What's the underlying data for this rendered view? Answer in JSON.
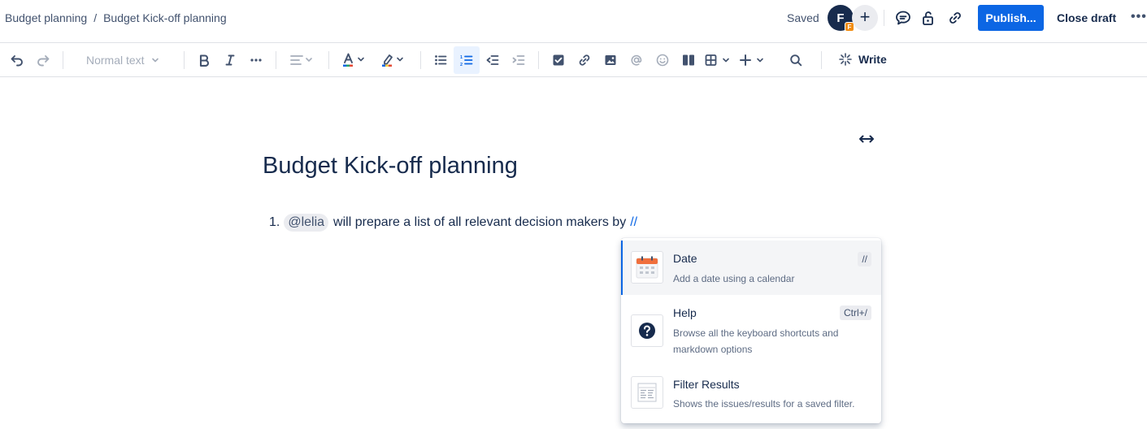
{
  "breadcrumb": {
    "parent": "Budget planning",
    "separator": "/",
    "current": "Budget Kick-off planning"
  },
  "header": {
    "status": "Saved",
    "avatar_initial": "F",
    "avatar_badge": "F",
    "add_label": "+",
    "publish_label": "Publish...",
    "close_label": "Close draft",
    "more_label": "•••"
  },
  "toolbar": {
    "text_style": "Normal text",
    "write_label": "Write"
  },
  "editor": {
    "title": "Budget Kick-off planning",
    "list_number": "1.",
    "mention": "@lelia",
    "body_text": "will prepare a list of all relevant decision makers by",
    "trigger": "//"
  },
  "menu": {
    "items": [
      {
        "title": "Date",
        "description": "Add a date using a calendar",
        "shortcut": "//",
        "icon": "calendar-icon"
      },
      {
        "title": "Help",
        "description": "Browse all the keyboard shortcuts and markdown options",
        "shortcut": "Ctrl+/",
        "icon": "question-icon"
      },
      {
        "title": "Filter Results",
        "description": "Shows the issues/results for a saved filter.",
        "icon": "filter-results-icon"
      }
    ]
  },
  "colors": {
    "primary": "#0c66e4",
    "text": "#172b4d",
    "badge": "#f18d13"
  }
}
